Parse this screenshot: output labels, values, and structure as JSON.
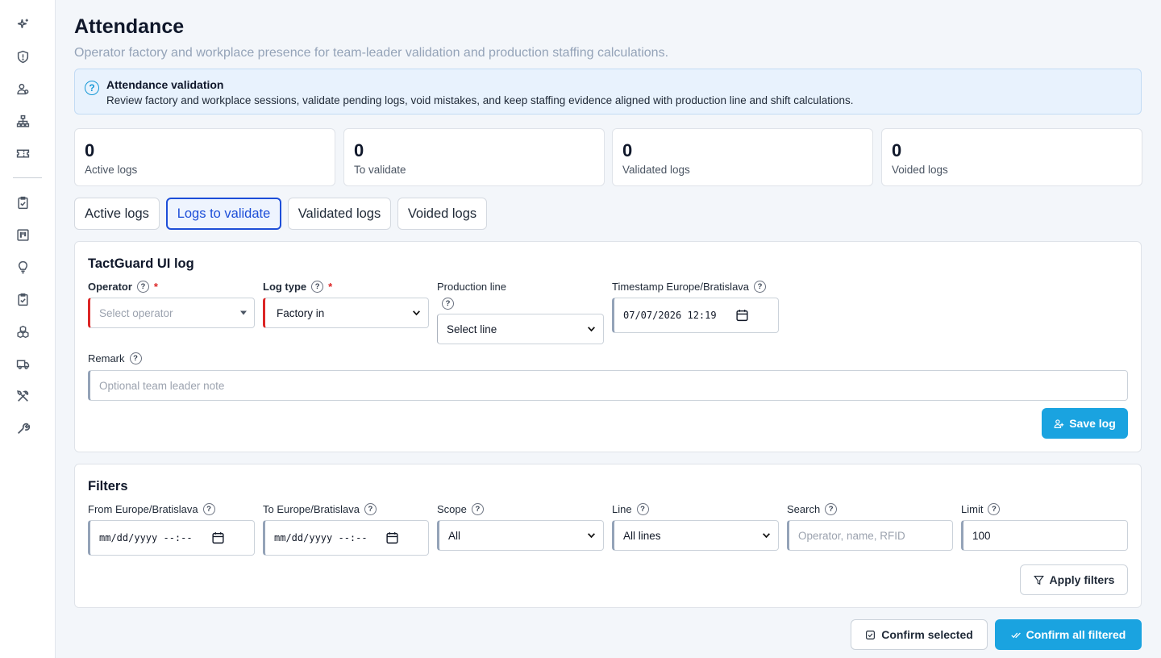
{
  "sidebar": {
    "items": [
      {
        "icon": "sparkle-icon"
      },
      {
        "icon": "shield-icon"
      },
      {
        "icon": "users-icon"
      },
      {
        "icon": "org-chart-icon"
      },
      {
        "icon": "ticket-icon"
      },
      {
        "icon": "clipboard-check-icon"
      },
      {
        "icon": "kanban-icon"
      },
      {
        "icon": "lightbulb-icon"
      },
      {
        "icon": "clipboard-icon"
      },
      {
        "icon": "boxes-icon"
      },
      {
        "icon": "truck-icon"
      },
      {
        "icon": "tools-icon"
      },
      {
        "icon": "wrench-icon"
      }
    ]
  },
  "header": {
    "title": "Attendance",
    "subtitle": "Operator factory and workplace presence for team-leader validation and production staffing calculations."
  },
  "info": {
    "title": "Attendance validation",
    "text": "Review factory and workplace sessions, validate pending logs, void mistakes, and keep staffing evidence aligned with production line and shift calculations."
  },
  "stats": [
    {
      "value": "0",
      "label": "Active logs"
    },
    {
      "value": "0",
      "label": "To validate"
    },
    {
      "value": "0",
      "label": "Validated logs"
    },
    {
      "value": "0",
      "label": "Voided logs"
    }
  ],
  "tabs": [
    {
      "label": "Active logs",
      "active": false
    },
    {
      "label": "Logs to validate",
      "active": true
    },
    {
      "label": "Validated logs",
      "active": false
    },
    {
      "label": "Voided logs",
      "active": false
    }
  ],
  "log_form": {
    "title": "TactGuard UI log",
    "operator": {
      "label": "Operator",
      "required_mark": "*",
      "placeholder": "Select operator"
    },
    "log_type": {
      "label": "Log type",
      "required_mark": "*",
      "value": "Factory in"
    },
    "production_line": {
      "label": "Production line",
      "value": "Select line"
    },
    "timestamp": {
      "label": "Timestamp Europe/Bratislava",
      "value": "07/07/2026 12:19"
    },
    "remark": {
      "label": "Remark",
      "placeholder": "Optional team leader note"
    },
    "save_label": "Save log"
  },
  "filters": {
    "title": "Filters",
    "from": {
      "label": "From Europe/Bratislava",
      "placeholder": "mm/dd/yyyy --:--"
    },
    "to": {
      "label": "To Europe/Bratislava",
      "placeholder": "mm/dd/yyyy --:--"
    },
    "scope": {
      "label": "Scope",
      "value": "All"
    },
    "line": {
      "label": "Line",
      "value": "All lines"
    },
    "search": {
      "label": "Search",
      "placeholder": "Operator, name, RFID"
    },
    "limit": {
      "label": "Limit",
      "value": "100"
    },
    "apply_label": "Apply filters"
  },
  "actions": {
    "confirm_selected": "Confirm selected",
    "confirm_all": "Confirm all filtered"
  },
  "colors": {
    "primary": "#1aa3e0",
    "active_tab": "#1d4ed8",
    "required": "#dc2626",
    "info_bg": "#e8f2fd"
  }
}
